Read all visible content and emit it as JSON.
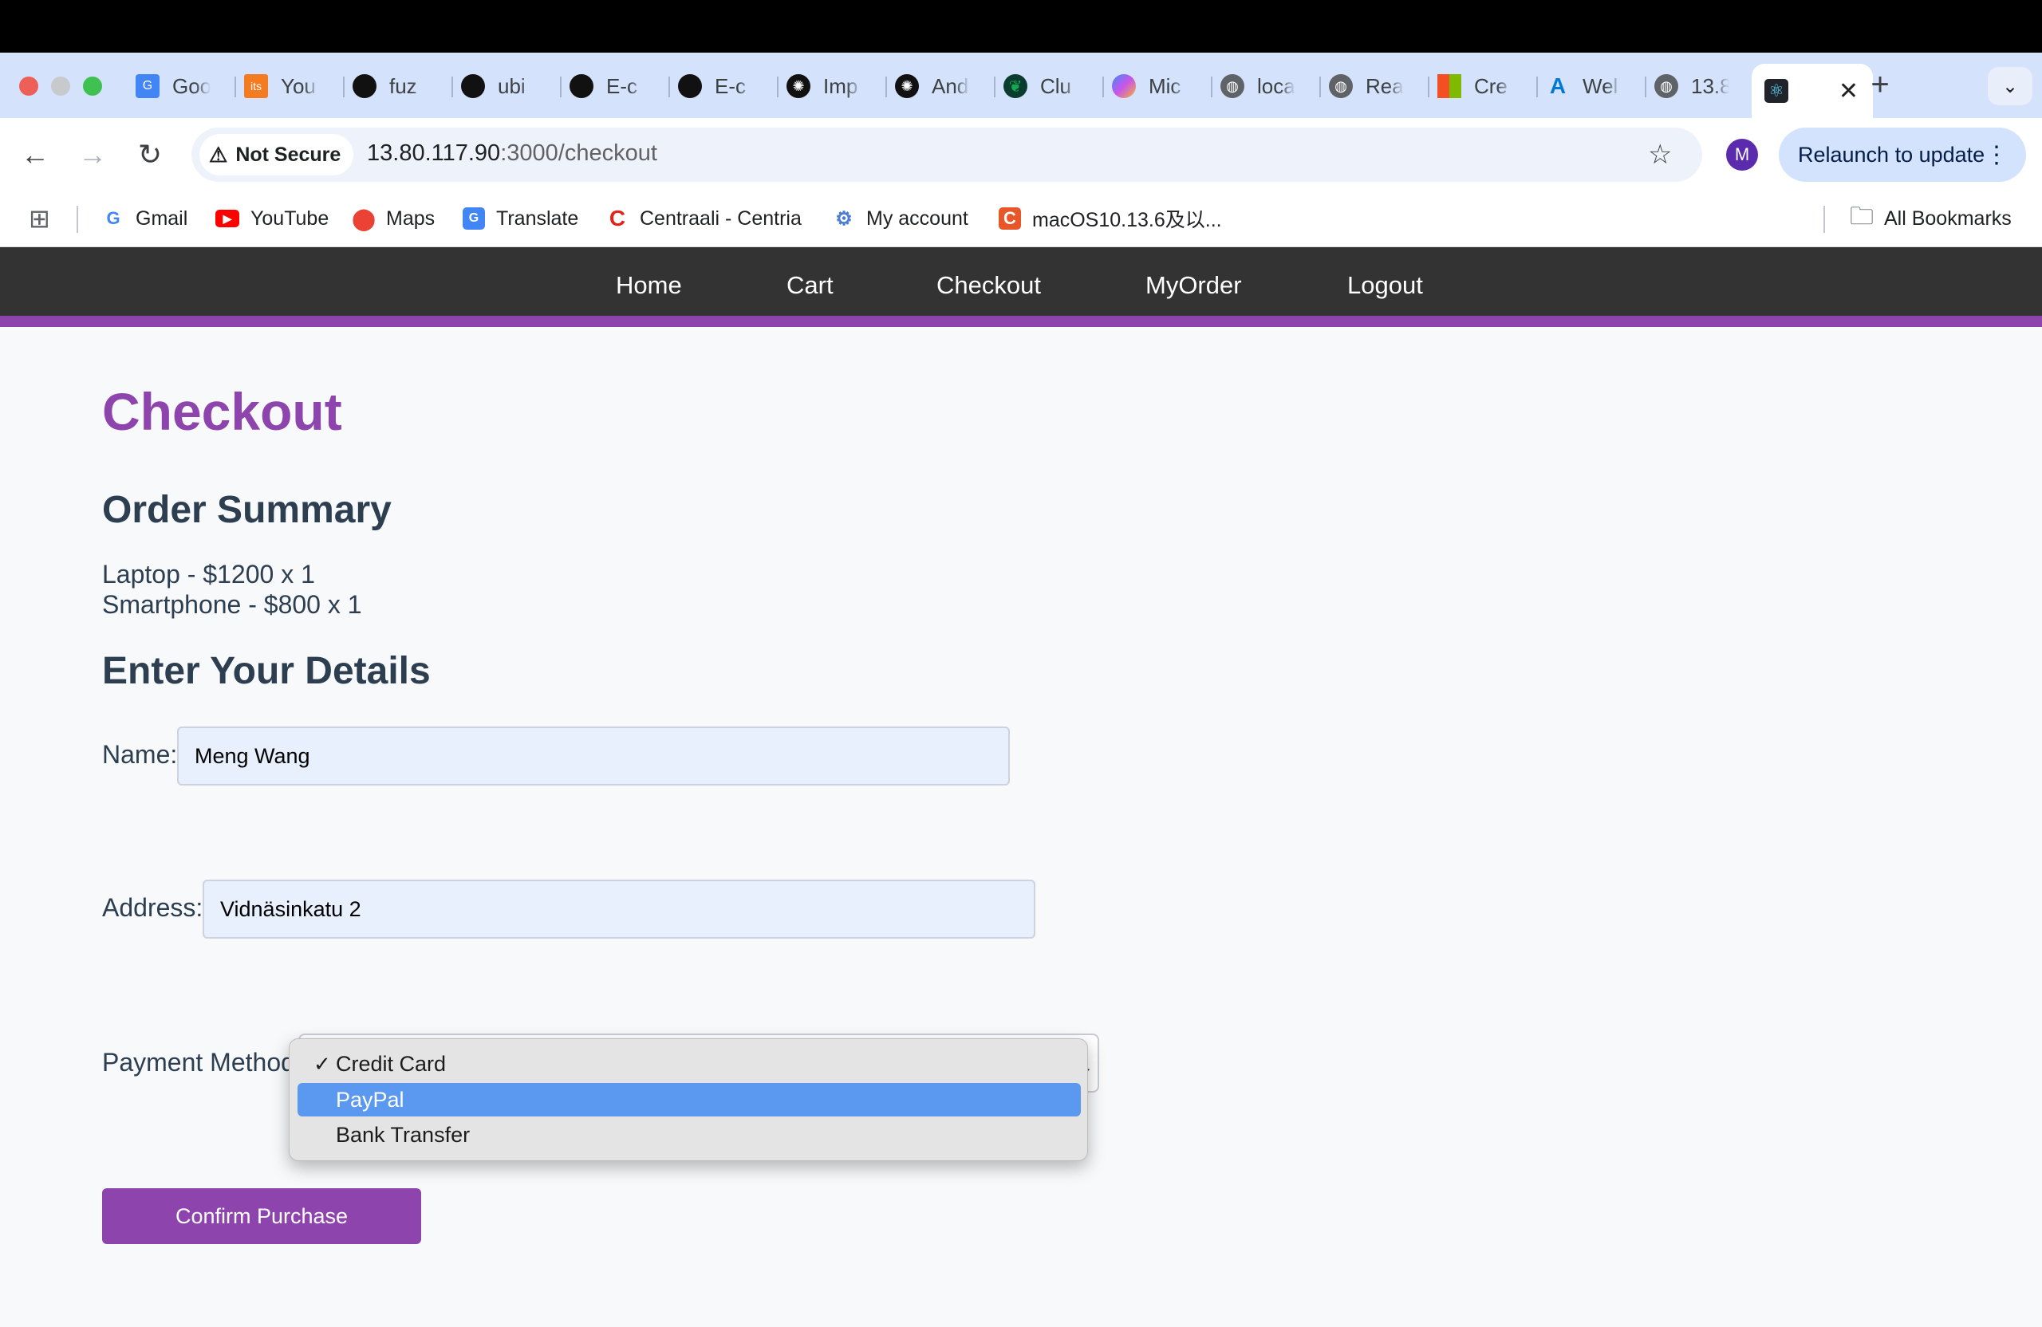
{
  "browser": {
    "tabs": [
      {
        "title": "Goo",
        "icon": "google-translate-icon"
      },
      {
        "title": "You",
        "icon": "its-learning-icon"
      },
      {
        "title": "fuz",
        "icon": "github-icon"
      },
      {
        "title": "ubi",
        "icon": "github-icon"
      },
      {
        "title": "E-c",
        "icon": "github-icon"
      },
      {
        "title": "E-c",
        "icon": "github-icon"
      },
      {
        "title": "Imp",
        "icon": "openai-icon"
      },
      {
        "title": "And",
        "icon": "openai-icon"
      },
      {
        "title": "Clu",
        "icon": "mongodb-icon"
      },
      {
        "title": "Mic",
        "icon": "copilot-icon"
      },
      {
        "title": "loca",
        "icon": "globe-icon"
      },
      {
        "title": "Rea",
        "icon": "globe-icon"
      },
      {
        "title": "Cre",
        "icon": "microsoft-icon"
      },
      {
        "title": "Wel",
        "icon": "azure-icon"
      },
      {
        "title": "13.8",
        "icon": "globe-icon"
      }
    ],
    "active_tab_icon": "react-icon",
    "security_label": "Not Secure",
    "url_host": "13.80.117.90",
    "url_path": ":3000/checkout",
    "profile_initial": "M",
    "relaunch_label": "Relaunch to update",
    "bookmarks": [
      {
        "label": "Gmail",
        "icon": "google-icon"
      },
      {
        "label": "YouTube",
        "icon": "youtube-icon"
      },
      {
        "label": "Maps",
        "icon": "maps-icon"
      },
      {
        "label": "Translate",
        "icon": "translate-icon"
      },
      {
        "label": "Centraali - Centria",
        "icon": "centria-icon"
      },
      {
        "label": "My account",
        "icon": "account-icon"
      },
      {
        "label": "macOS10.13.6及以...",
        "icon": "c-icon"
      }
    ],
    "all_bookmarks_label": "All Bookmarks"
  },
  "site_nav": {
    "home": "Home",
    "cart": "Cart",
    "checkout": "Checkout",
    "myorder": "MyOrder",
    "logout": "Logout"
  },
  "page": {
    "title": "Checkout",
    "summary_heading": "Order Summary",
    "items": [
      "Laptop - $1200 x 1",
      "Smartphone - $800 x 1"
    ],
    "details_heading": "Enter Your Details",
    "name_label": "Name:",
    "name_value": "Meng Wang",
    "address_label": "Address:",
    "address_value": "Vidnäsinkatu 2",
    "payment_label": "Payment Method:",
    "payment_options": [
      "Credit Card",
      "PayPal",
      "Bank Transfer"
    ],
    "payment_selected": "Credit Card",
    "payment_highlighted": "PayPal",
    "confirm_label": "Confirm Purchase"
  },
  "colors": {
    "accent": "#8e44ad",
    "nav_bg": "#333333",
    "heading": "#2c3e50",
    "highlight": "#5b98ef"
  }
}
